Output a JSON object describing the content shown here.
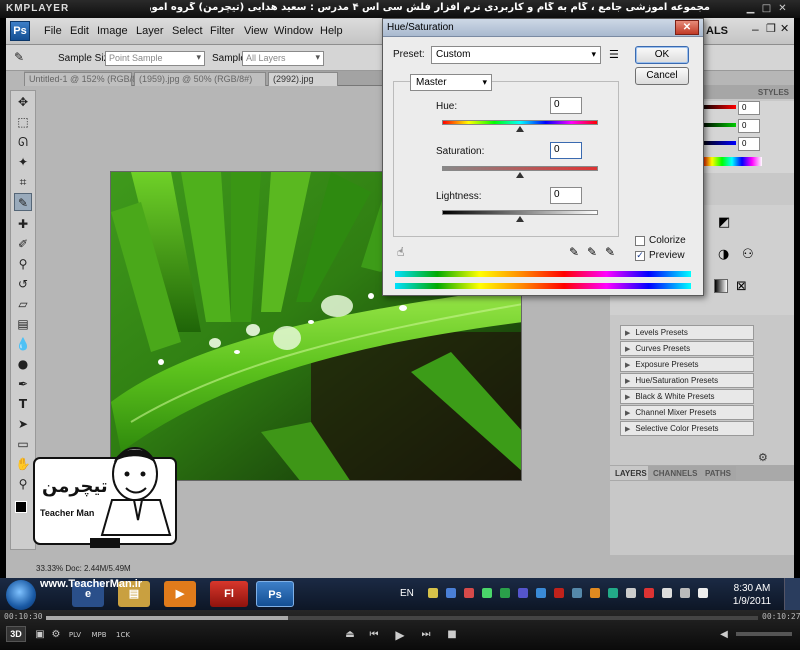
{
  "window_title": "مجموعه آموزشی جامع ، گام به گام و کاربردی نرم افزار فلش سی اس ۴ مدرس : سعید هدایی (تیچرمن) گروه آموزشی پادشاه گرافیست ها",
  "player": {
    "logo": "KMPLAYER",
    "time_elapsed": "00:10:30",
    "time_total": "00:10:27",
    "progress_fraction": 0.34,
    "mode_badges": [
      "PLV",
      "MPB",
      "1CK"
    ],
    "three_d": "3D"
  },
  "photoshop": {
    "logo": "Ps",
    "menu": [
      "File",
      "Edit",
      "Image",
      "Layer",
      "Select",
      "Filter",
      "View",
      "Window",
      "Help"
    ],
    "workspace": "ALS",
    "options_bar": {
      "sample_size_label": "Sample Size:",
      "sample_size_value": "Point Sample",
      "sample_label": "Sample:",
      "sample_value": "All Layers"
    },
    "tabs": [
      "Untitled-1 @ 152% (RGB/8)",
      "(1959).jpg @ 50% (RGB/8#)",
      "(2992).jpg"
    ],
    "status_text": "33.33%    Doc: 2.44M/5.49M",
    "right_panel": {
      "styles_tab": "STYLES",
      "color_values": [
        "0",
        "0",
        "0"
      ],
      "adjustment_presets": [
        "Levels Presets",
        "Curves Presets",
        "Exposure Presets",
        "Hue/Saturation Presets",
        "Black & White Presets",
        "Channel Mixer Presets",
        "Selective Color Presets"
      ],
      "layers_tabs": [
        "LAYERS",
        "CHANNELS",
        "PATHS"
      ]
    }
  },
  "dialog": {
    "title": "Hue/Saturation",
    "preset_label": "Preset:",
    "preset_value": "Custom",
    "ok_label": "OK",
    "cancel_label": "Cancel",
    "channel_value": "Master",
    "hue_label": "Hue:",
    "hue_value": "0",
    "saturation_label": "Saturation:",
    "saturation_value": "0",
    "lightness_label": "Lightness:",
    "lightness_value": "0",
    "colorize_label": "Colorize",
    "colorize_checked": false,
    "preview_label": "Preview",
    "preview_checked": true
  },
  "taskbar": {
    "language": "EN",
    "time": "8:30 AM",
    "date": "1/9/2011",
    "apps": [
      "Fl",
      "Ps"
    ]
  },
  "watermark": {
    "site": "www.TeacherMan.ir",
    "brand": "Teacher Man"
  },
  "colors": {
    "accent_blue": "#1a5aa5",
    "flash_red": "#c0221b",
    "ps_blue": "#2e6db4"
  }
}
